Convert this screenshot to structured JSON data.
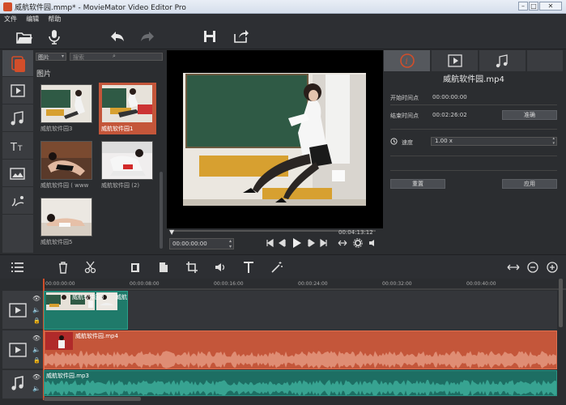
{
  "window": {
    "title": "威航软件园.mmp* - MovieMator Video Editor Pro"
  },
  "menu": {
    "items": [
      "文件",
      "编辑",
      "帮助"
    ]
  },
  "library": {
    "filter_selected": "图片",
    "search_placeholder": "搜索",
    "section_title": "图片",
    "items": [
      {
        "caption": "威航软件园3"
      },
      {
        "caption": "威航软件园1"
      },
      {
        "caption": "威航软件园 ( www"
      },
      {
        "caption": "威航软件园 (2)"
      },
      {
        "caption": "威航软件园5"
      }
    ],
    "selected_index": 1
  },
  "player": {
    "duration": "00:04:13:12",
    "current_time": "00:00:00:00"
  },
  "properties": {
    "file_name": "威航软件园.mp4",
    "start_label": "开始时间点",
    "start_value": "00:00:00:00",
    "end_label": "结束时间点",
    "end_value": "00:02:26:02",
    "end_button": "准确",
    "speed_label": "速度",
    "speed_value": "1.00 x",
    "reset_button": "重置",
    "apply_button": "应用"
  },
  "timeline": {
    "ruler_ticks": [
      "00:00:00:00",
      "00:00:08:00",
      "00:00:16:00",
      "00:00:24:00",
      "00:00:32:00",
      "00:00:40:00"
    ],
    "tracks": [
      {
        "type": "video",
        "clips": [
          {
            "label": "威航软件园3"
          },
          {
            "label": "威航"
          }
        ]
      },
      {
        "type": "video",
        "clips": [
          {
            "label": "威航软件园.mp4"
          }
        ]
      },
      {
        "type": "audio",
        "clips": [
          {
            "label": "威航软件园.mp3"
          }
        ]
      }
    ]
  },
  "colors": {
    "accent": "#d24e2a",
    "video_clip": "#1f7a6a",
    "main_clip": "#c4563a",
    "audio_clip": "#1d6e63"
  }
}
